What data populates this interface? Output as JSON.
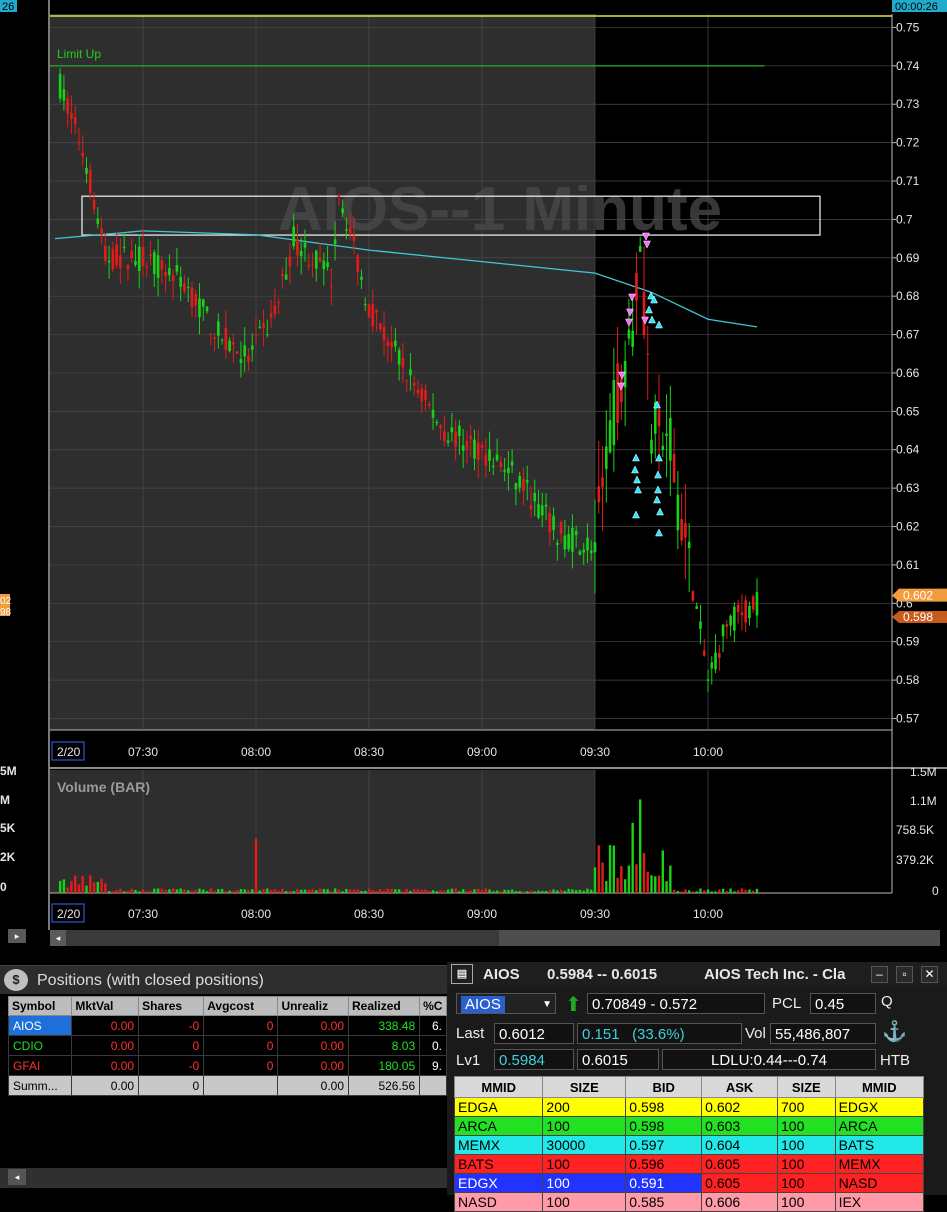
{
  "chart": {
    "title": "AIOS--1 Minute",
    "limit_up_label": "Limit Up",
    "volume_label": "Volume (BAR)",
    "date_label": "2/20",
    "time_labels": [
      "07:30",
      "08:00",
      "08:30",
      "09:00",
      "09:30",
      "10:00"
    ],
    "price_ticks": [
      "0.75",
      "0.74",
      "0.73",
      "0.72",
      "0.71",
      "0.7",
      "0.69",
      "0.68",
      "0.67",
      "0.66",
      "0.65",
      "0.64",
      "0.63",
      "0.62",
      "0.61",
      "0.6",
      "0.59",
      "0.58",
      "0.57"
    ],
    "volume_ticks": [
      "1.5M",
      "1.1M",
      "758.5K",
      "379.2K",
      "0"
    ],
    "clock": "00:00:26",
    "last_price_tag": "0.602",
    "bid_price_tag": "0.598",
    "left_clip_labels": [
      "26",
      "02",
      "98",
      "5M",
      "M",
      "5K",
      "2K",
      "0"
    ],
    "colors": {
      "up": "#17d317",
      "down": "#e31b1b",
      "vwap": "#3ec8d8",
      "limit": "#2aa12a",
      "clock_line": "#e1e14a",
      "premarket_bg": "#2e2e2e",
      "market_bg": "#000000"
    }
  },
  "chart_data": [
    {
      "type": "candlestick",
      "title": "AIOS--1 Minute",
      "x_range": [
        "07:07",
        "10:15"
      ],
      "ylim": [
        0.567,
        0.762
      ],
      "approximate_path": [
        {
          "time": "07:08",
          "price": 0.735
        },
        {
          "time": "07:15",
          "price": 0.715
        },
        {
          "time": "07:20",
          "price": 0.69
        },
        {
          "time": "07:30",
          "price": 0.69
        },
        {
          "time": "07:40",
          "price": 0.685
        },
        {
          "time": "07:50",
          "price": 0.67
        },
        {
          "time": "07:58",
          "price": 0.664
        },
        {
          "time": "08:05",
          "price": 0.675
        },
        {
          "time": "08:10",
          "price": 0.695
        },
        {
          "time": "08:20",
          "price": 0.685
        },
        {
          "time": "08:22",
          "price": 0.708
        },
        {
          "time": "08:30",
          "price": 0.677
        },
        {
          "time": "08:40",
          "price": 0.66
        },
        {
          "time": "08:50",
          "price": 0.645
        },
        {
          "time": "09:00",
          "price": 0.64
        },
        {
          "time": "09:10",
          "price": 0.632
        },
        {
          "time": "09:20",
          "price": 0.618
        },
        {
          "time": "09:30",
          "price": 0.615
        },
        {
          "time": "09:35",
          "price": 0.65
        },
        {
          "time": "09:40",
          "price": 0.675
        },
        {
          "time": "09:42",
          "price": 0.695
        },
        {
          "time": "09:45",
          "price": 0.645
        },
        {
          "time": "09:50",
          "price": 0.64
        },
        {
          "time": "10:00",
          "price": 0.58
        },
        {
          "time": "10:05",
          "price": 0.595
        },
        {
          "time": "10:13",
          "price": 0.6
        }
      ],
      "vwap": [
        {
          "time": "07:07",
          "price": 0.695
        },
        {
          "time": "07:30",
          "price": 0.697
        },
        {
          "time": "08:00",
          "price": 0.696
        },
        {
          "time": "08:30",
          "price": 0.692
        },
        {
          "time": "09:00",
          "price": 0.689
        },
        {
          "time": "09:30",
          "price": 0.686
        },
        {
          "time": "09:45",
          "price": 0.681
        },
        {
          "time": "10:00",
          "price": 0.674
        },
        {
          "time": "10:13",
          "price": 0.672
        }
      ],
      "limit_up": 0.74,
      "highlight_zone": [
        0.698,
        0.705
      ]
    },
    {
      "type": "bar",
      "title": "Volume (BAR)",
      "ylim": [
        0,
        1500000
      ],
      "notable_bars": [
        {
          "time": "08:00",
          "value": 700000
        },
        {
          "time": "09:40",
          "value": 900000
        },
        {
          "time": "09:42",
          "value": 1200000
        }
      ]
    }
  ],
  "positions": {
    "title": "Positions (with closed positions)",
    "columns": [
      "Symbol",
      "MktVal",
      "Shares",
      "Avgcost",
      "Unrealiz",
      "Realized",
      "%C"
    ],
    "rows": [
      {
        "symbol": "AIOS",
        "mktval": "0.00",
        "shares": "-0",
        "avgcost": "0",
        "unreal": "0.00",
        "realized": "338.48",
        "pct": "6."
      },
      {
        "symbol": "CDIO",
        "mktval": "0.00",
        "shares": "0",
        "avgcost": "0",
        "unreal": "0.00",
        "realized": "8.03",
        "pct": "0."
      },
      {
        "symbol": "GFAI",
        "mktval": "0.00",
        "shares": "-0",
        "avgcost": "0",
        "unreal": "0.00",
        "realized": "180.05",
        "pct": "9."
      }
    ],
    "summary": {
      "symbol": "Summ...",
      "mktval": "0.00",
      "shares": "0",
      "avgcost": "",
      "unreal": "0.00",
      "realized": "526.56",
      "pct": ""
    }
  },
  "level2": {
    "symbol": "AIOS",
    "quote": "0.5984 -- 0.6015",
    "company": "AIOS Tech Inc. - Cla",
    "symbol_input": "AIOS",
    "range": "0.70849 - 0.572",
    "pcl_label": "PCL",
    "pcl": "0.45",
    "q": "Q",
    "last_label": "Last",
    "last": "0.6012",
    "change": "0.151",
    "change_pct": "(33.6%)",
    "vol_label": "Vol",
    "vol": "55,486,807",
    "lv1_label": "Lv1",
    "lv1_bid": "0.5984",
    "lv1_ask": "0.6015",
    "ldlu": "LDLU:0.44---0.74",
    "htb": "HTB",
    "anchor": "⚓",
    "columns": [
      "MMID",
      "SIZE",
      "BID",
      "ASK",
      "SIZE",
      "MMID"
    ],
    "rows": [
      {
        "bmm": "EDGA",
        "bsz": "200",
        "bid": "0.598",
        "ask": "0.602",
        "asz": "700",
        "amm": "EDGX",
        "bc": "#ffff00",
        "ac": "#ffff00"
      },
      {
        "bmm": "ARCA",
        "bsz": "100",
        "bid": "0.598",
        "ask": "0.603",
        "asz": "100",
        "amm": "ARCA",
        "bc": "#22e022",
        "ac": "#22e022"
      },
      {
        "bmm": "MEMX",
        "bsz": "30000",
        "bid": "0.597",
        "ask": "0.604",
        "asz": "100",
        "amm": "BATS",
        "bc": "#22e8e8",
        "ac": "#22e8e8"
      },
      {
        "bmm": "BATS",
        "bsz": "100",
        "bid": "0.596",
        "ask": "0.605",
        "asz": "100",
        "amm": "MEMX",
        "bc": "#ff2222",
        "ac": "#ff2222"
      },
      {
        "bmm": "EDGX",
        "bsz": "100",
        "bid": "0.591",
        "ask": "0.605",
        "asz": "100",
        "amm": "NASD",
        "bc": "#2233ff",
        "ac": "#ff2222"
      },
      {
        "bmm": "NASD",
        "bsz": "100",
        "bid": "0.585",
        "ask": "0.606",
        "asz": "100",
        "amm": "IEX",
        "bc": "#ff9aa8",
        "ac": "#ff9aa8"
      }
    ]
  }
}
